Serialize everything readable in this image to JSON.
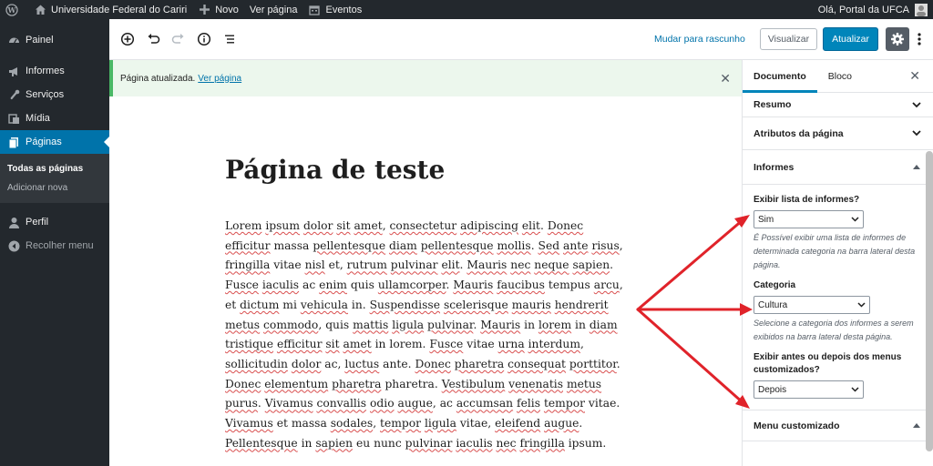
{
  "admin_bar": {
    "site_name": "Universidade Federal do Cariri",
    "new_label": "Novo",
    "view_page_label": "Ver página",
    "events_label": "Eventos",
    "greeting": "Olá, Portal da UFCA"
  },
  "sidebar": {
    "items": [
      {
        "label": "Painel",
        "icon": "dashboard-icon"
      },
      {
        "label": "Informes",
        "icon": "megaphone-icon"
      },
      {
        "label": "Serviços",
        "icon": "wrench-icon"
      },
      {
        "label": "Mídia",
        "icon": "media-icon"
      },
      {
        "label": "Páginas",
        "icon": "pages-icon"
      }
    ],
    "submenu": [
      "Todas as páginas",
      "Adicionar nova"
    ],
    "profile_label": "Perfil",
    "collapse_label": "Recolher menu"
  },
  "toolbar": {
    "switch_draft_label": "Mudar para rascunho",
    "preview_label": "Visualizar",
    "update_label": "Atualizar"
  },
  "notice": {
    "text": "Página atualizada.",
    "link": "Ver página"
  },
  "content": {
    "title": "Página de teste",
    "body": "Lorem ipsum dolor sit amet, consectetur adipiscing elit. Donec efficitur massa pellentesque diam pellentesque mollis. Sed ante risus, fringilla vitae nisl et, rutrum pulvinar elit. Mauris nec neque sapien. Fusce iaculis ac enim quis ullamcorper. Mauris faucibus tempus arcu, et dictum mi vehicula in. Suspendisse scelerisque mauris hendrerit metus commodo, quis mattis ligula pulvinar. Mauris in lorem in diam tristique efficitur sit amet in lorem. Fusce vitae urna interdum, sollicitudin dolor ac, luctus ante. Donec pharetra consequat porttitor. Donec elementum pharetra pharetra. Vestibulum venenatis metus purus. Vivamus convallis odio augue, ac accumsan felis tempor vitae. Vivamus et massa sodales, tempor ligula vitae, eleifend augue. Pellentesque in sapien eu nunc pulvinar iaculis nec fringilla ipsum."
  },
  "settings": {
    "tabs": [
      "Documento",
      "Bloco"
    ],
    "panels": {
      "summary": "Resumo",
      "attributes": "Atributos da página",
      "informes": "Informes",
      "custom_menu": "Menu customizado"
    },
    "informes": {
      "show_list_label": "Exibir lista de informes?",
      "show_list_value": "Sim",
      "show_list_help": "É Possível exibir uma lista de informes de determinada categoria na barra lateral desta página.",
      "category_label": "Categoria",
      "category_value": "Cultura",
      "category_help": "Selecione a categoria dos informes a serem exibidos na barra lateral desta página.",
      "position_label": "Exibir antes ou depois dos menus customizados?",
      "position_value": "Depois"
    }
  },
  "colors": {
    "admin_bar": "#23282d",
    "active_menu": "#0073aa",
    "update_button": "#0085ba",
    "notice_bg": "#ecf7ed",
    "notice_border": "#4ab866",
    "arrow": "#e0232a"
  }
}
